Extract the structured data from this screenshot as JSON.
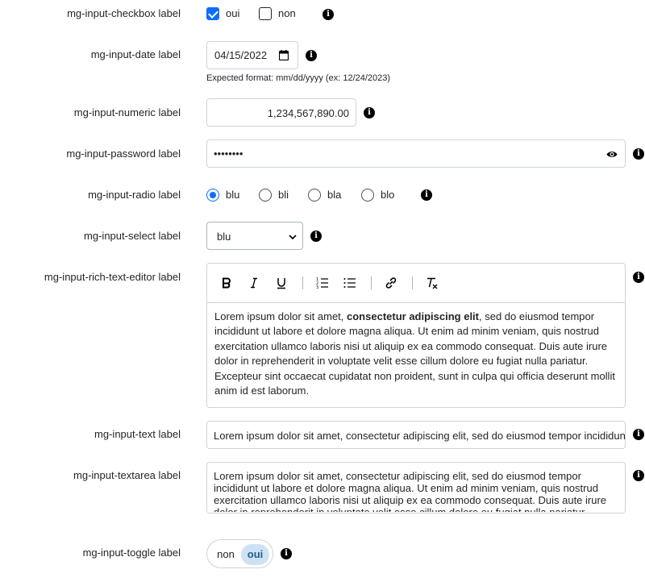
{
  "checkbox": {
    "label": "mg-input-checkbox label",
    "options": [
      {
        "label": "oui",
        "checked": true
      },
      {
        "label": "non",
        "checked": false
      }
    ],
    "info_icon": "info-icon"
  },
  "date": {
    "label": "mg-input-date label",
    "value": "04/15/2022",
    "help": "Expected format: mm/dd/yyyy (ex: 12/24/2023)",
    "calendar_icon": "calendar-icon",
    "info_icon": "info-icon"
  },
  "numeric": {
    "label": "mg-input-numeric label",
    "value": "1,234,567,890.00",
    "info_icon": "info-icon"
  },
  "password": {
    "label": "mg-input-password label",
    "value": "••••••••",
    "eye_icon": "eye-icon",
    "info_icon": "info-icon"
  },
  "radio": {
    "label": "mg-input-radio label",
    "options": [
      {
        "label": "blu",
        "selected": true
      },
      {
        "label": "bli",
        "selected": false
      },
      {
        "label": "bla",
        "selected": false
      },
      {
        "label": "blo",
        "selected": false
      }
    ],
    "info_icon": "info-icon"
  },
  "select": {
    "label": "mg-input-select label",
    "value": "blu",
    "info_icon": "info-icon"
  },
  "rich_text": {
    "label": "mg-input-rich-text-editor label",
    "toolbar": [
      "bold-icon",
      "italic-icon",
      "underline-icon",
      "ordered-list-icon",
      "bullet-list-icon",
      "link-icon",
      "clear-format-icon"
    ],
    "text_before": "Lorem ipsum dolor sit amet, ",
    "text_bold": "consectetur adipiscing elit",
    "text_after": ", sed do eiusmod tempor incididunt ut labore et dolore magna aliqua. Ut enim ad minim veniam, quis nostrud exercitation ullamco laboris nisi ut aliquip ex ea commodo consequat. Duis aute irure dolor in reprehenderit in voluptate velit esse cillum dolore eu fugiat nulla pariatur. Excepteur sint occaecat cupidatat non proident, sunt in culpa qui officia deserunt mollit anim id est laborum.",
    "info_icon": "info-icon"
  },
  "text": {
    "label": "mg-input-text label",
    "value": "Lorem ipsum dolor sit amet, consectetur adipiscing elit, sed do eiusmod tempor incididunt ut labore",
    "info_icon": "info-icon"
  },
  "textarea": {
    "label": "mg-input-textarea label",
    "value": "Lorem ipsum dolor sit amet, consectetur adipiscing elit, sed do eiusmod tempor incididunt ut labore et dolore magna aliqua. Ut enim ad minim veniam, quis nostrud exercitation ullamco laboris nisi ut aliquip ex ea commodo consequat. Duis aute irure dolor in reprehenderit in voluptate velit esse cillum dolore eu fugiat nulla pariatur.",
    "info_icon": "info-icon"
  },
  "toggle": {
    "label": "mg-input-toggle label",
    "off_label": "non",
    "on_label": "oui",
    "value": "oui",
    "info_icon": "info-icon"
  },
  "colors": {
    "accent": "#0d6efd",
    "border": "#ced4da",
    "toggle_active_bg": "#cfe2f3",
    "toggle_active_text": "#1c5e91"
  }
}
